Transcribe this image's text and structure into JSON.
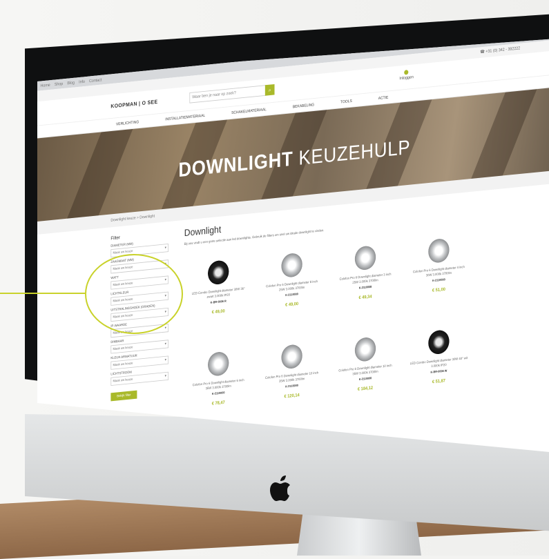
{
  "colors": {
    "accent": "#a9b92a",
    "callout": "#c9d22a",
    "bezel": "#0f1011"
  },
  "browser": {
    "tabs": [
      "Home",
      "Shop",
      "Blog",
      "Info",
      "Contact"
    ]
  },
  "topbar": {
    "phone": "☎ +31 (0) 342 - 392222"
  },
  "header": {
    "logo": "KOOPMAN | O SEE",
    "search_placeholder": "Waar ben je naar op zoek?",
    "search_icon": "search-icon",
    "login_label": "Inloggen"
  },
  "nav": {
    "items": [
      "VERLICHTING",
      "INSTALLATIEMATERIAAL",
      "SCHAKELMATERIAAL",
      "BEKABELING",
      "TOOLS",
      "ACTIE"
    ]
  },
  "hero": {
    "title_bold": "DOWNLIGHT",
    "title_rest": " KEUZEHULP"
  },
  "breadcrumb": {
    "text": "Downlight keuze  >  Downlight"
  },
  "filters": {
    "title": "Filter",
    "groups": [
      {
        "label": "Diameter (mm)",
        "value": "Maak uw keuze"
      },
      {
        "label": "Zaagmaat (mm)",
        "value": "Maak uw keuze"
      },
      {
        "label": "Watt",
        "value": "Maak uw keuze"
      },
      {
        "label": "Lichtkleur",
        "value": "Maak uw keuze"
      },
      {
        "label": "Uitstralingshoek (graden)",
        "value": "Maak uw keuze"
      },
      {
        "label": "IP-waarde",
        "value": "Maak uw keuze"
      },
      {
        "label": "Dimbaar",
        "value": "Maak uw keuze"
      },
      {
        "label": "Kleur armatuur",
        "value": "Maak uw keuze"
      },
      {
        "label": "Lichtstroom",
        "value": "Maak uw keuze"
      }
    ],
    "button": "Bekijk filter"
  },
  "main": {
    "title": "Downlight",
    "intro": "Bij ons vindt u een grote selectie aan led downlights. Gebruik de filters om snel uw ideale downlight te vinden."
  },
  "products": [
    {
      "name": "LED Combo Downlight diameter 30W 36° zwart 3.000k IP20",
      "code": "K-BR-0006 R",
      "price": "€ 49,00",
      "style": "black"
    },
    {
      "name": "Colofon Pro 6 Downlight diameter 8 inch 25W 3.000k 3700lm",
      "code": "K-2110000",
      "price": "€ 49,00",
      "style": "silver"
    },
    {
      "name": "Colofon Pro 6 Downlight diameter 3 inch 25W 3.000k 3700lm",
      "code": "K-2110008",
      "price": "€ 49,34",
      "style": "silver"
    },
    {
      "name": "Colofon Pro 6 Downlight diameter 4 inch 30W 3.000k 3700lm",
      "code": "K-2110000",
      "price": "€ 51,00",
      "style": "silver"
    },
    {
      "name": "Colofon Pro 6 Downlight diameter 6 inch 35W 3.000k 3700lm",
      "code": "K-2110000",
      "price": "€ 78,47",
      "style": "silver"
    },
    {
      "name": "Colofon Pro 6 Downlight diameter 10 inch 35W 3.000k 3700lm",
      "code": "K-2110000",
      "price": "€ 120,14",
      "style": "silver"
    },
    {
      "name": "Colofon Pro 6 Downlight diameter 10 inch 35W 3.000k 3700lm",
      "code": "K-2110006",
      "price": "€ 184,12",
      "style": "silver"
    },
    {
      "name": "LED Combo Downlight diameter 30W 40° wit 3.000k IP20",
      "code": "K-BR-0006 W",
      "price": "€ 51,87",
      "style": "black"
    }
  ]
}
